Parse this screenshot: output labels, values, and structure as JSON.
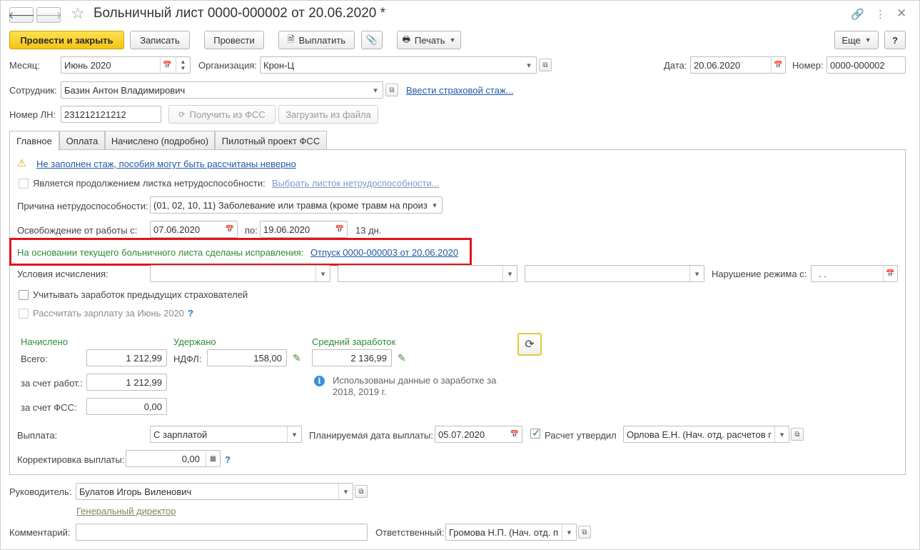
{
  "window": {
    "title": "Больничный лист 0000-000002 от 20.06.2020 *"
  },
  "toolbar": {
    "post_close": "Провести и закрыть",
    "save": "Записать",
    "post": "Провести",
    "pay": "Выплатить",
    "print": "Печать",
    "more": "Еще",
    "help": "?"
  },
  "header": {
    "month_label": "Месяц:",
    "month_value": "Июнь 2020",
    "org_label": "Организация:",
    "org_value": "Крон-Ц",
    "date_label": "Дата:",
    "date_value": "20.06.2020",
    "number_label": "Номер:",
    "number_value": "0000-000002",
    "employee_label": "Сотрудник:",
    "employee_value": "Базин Антон Владимирович",
    "insurance_link": "Ввести страховой стаж...",
    "ln_label": "Номер ЛН:",
    "ln_value": "231212121212",
    "get_fss": "Получить из ФСС",
    "load_file": "Загрузить из файла"
  },
  "tabs": [
    "Главное",
    "Оплата",
    "Начислено (подробно)",
    "Пилотный проект ФСС"
  ],
  "main": {
    "warning_link": "Не заполнен стаж, пособия могут быть рассчитаны неверно",
    "continuation_label": "Является продолжением листка нетрудоспособности:",
    "continuation_link": "Выбрать листок нетрудоспособности...",
    "reason_label": "Причина нетрудоспособности:",
    "reason_value": "(01, 02, 10, 11) Заболевание или травма (кроме травм на произ",
    "release_label": "Освобождение от работы с:",
    "release_from": "07.06.2020",
    "release_to_label": "по:",
    "release_to": "19.06.2020",
    "release_days": "13 дн.",
    "corrections_text": "На основании текущего больничного листа сделаны исправления:",
    "corrections_link": "Отпуск 0000-000003 от 20.06.2020",
    "conditions_label": "Условия исчисления:",
    "regime_label": "Нарушение режима с:",
    "regime_value": " .  .",
    "prev_insurers_label": "Учитывать заработок предыдущих страхователей",
    "calc_salary_label": "Рассчитать зарплату за Июнь 2020",
    "help_q": "?"
  },
  "accrued": {
    "title": "Начислено",
    "total_label": "Всего:",
    "total_value": "1 212,99",
    "employer_label": "за счет работ.:",
    "employer_value": "1 212,99",
    "fss_label": "за счет ФСС:",
    "fss_value": "0,00"
  },
  "withheld": {
    "title": "Удержано",
    "ndfl_label": "НДФЛ:",
    "ndfl_value": "158,00"
  },
  "average": {
    "title": "Средний заработок",
    "value": "2 136,99",
    "info_text_1": "Использованы данные о заработке за",
    "info_text_2": "2018,  2019 г."
  },
  "payment": {
    "label": "Выплата:",
    "value": "С зарплатой",
    "planned_label": "Планируемая дата выплаты:",
    "planned_value": "05.07.2020",
    "approved_label": "Расчет утвердил",
    "approved_value": "Орлова Е.Н. (Нач. отд. расчетов г",
    "correction_label": "Корректировка выплаты:",
    "correction_value": "0,00",
    "help_q": "?"
  },
  "footer": {
    "head_label": "Руководитель:",
    "head_value": "Булатов Игорь Виленович",
    "head_position": "Генеральный директор",
    "comment_label": "Комментарий:",
    "comment_value": "",
    "responsible_label": "Ответственный:",
    "responsible_value": "Громова Н.П. (Нач. отд. п"
  },
  "colors": {
    "primary_button": "#f6c412",
    "link": "#1f5aa8",
    "green_text": "#2f8b37",
    "highlight_box": "#e0141b"
  }
}
